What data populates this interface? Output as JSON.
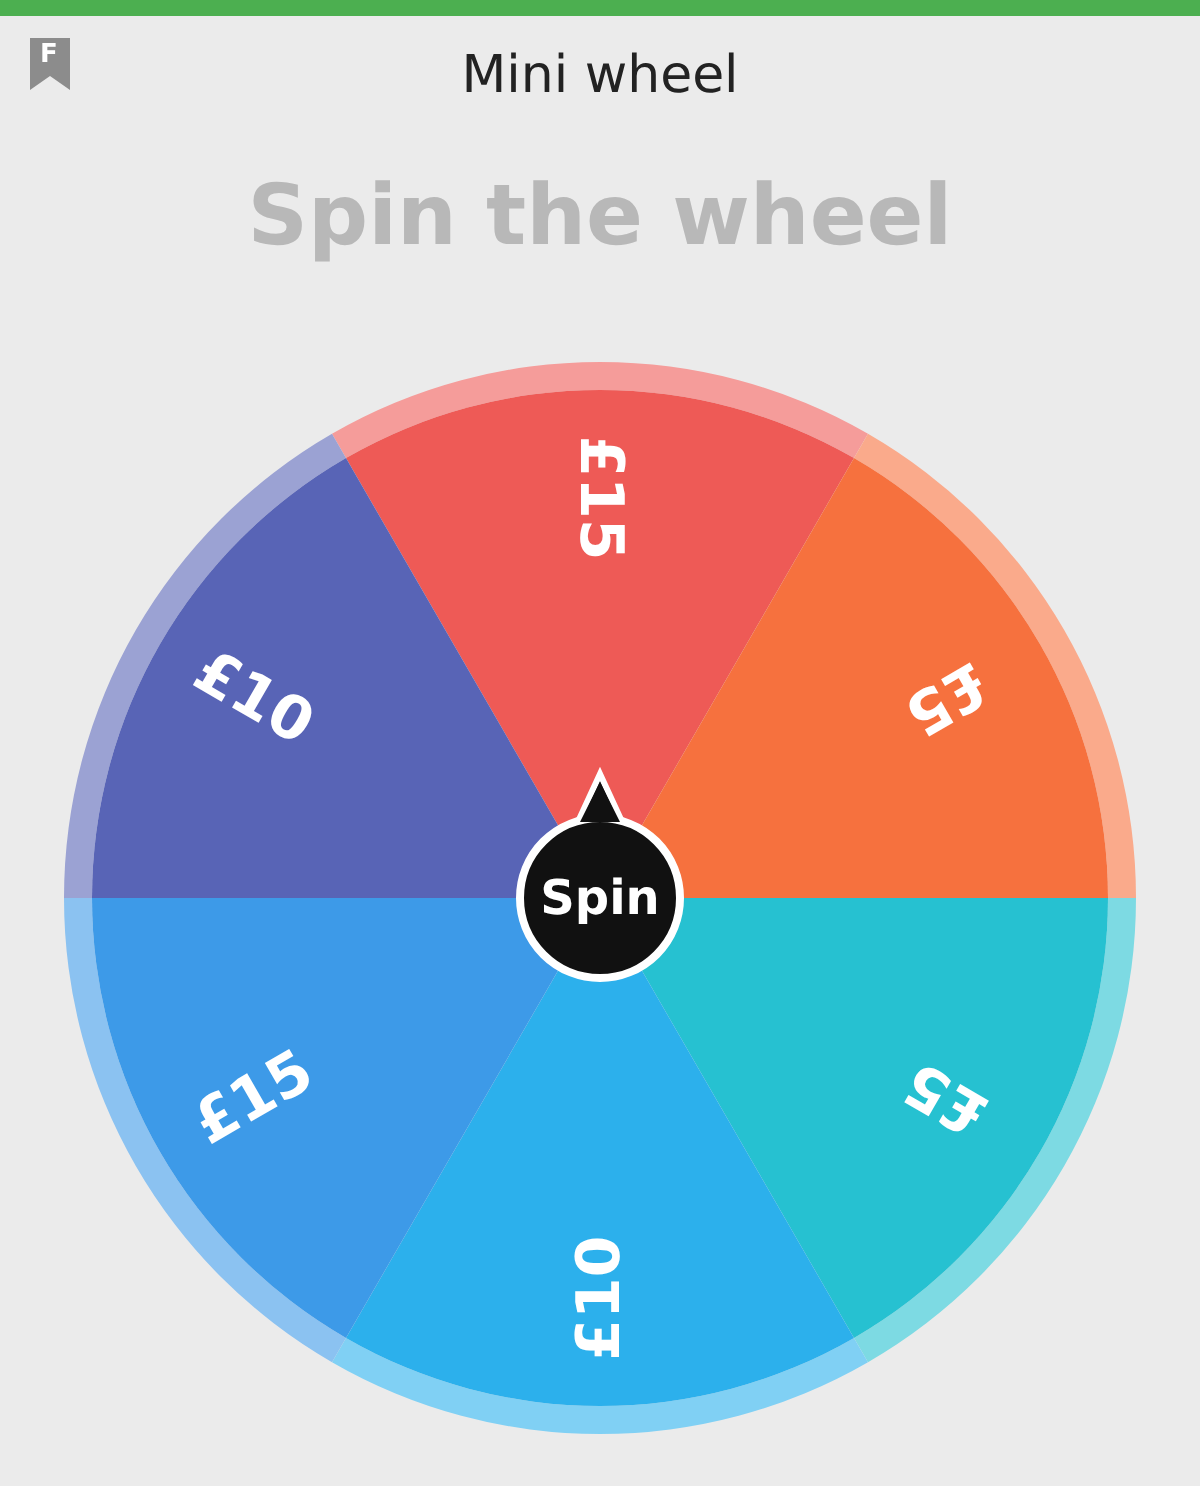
{
  "header": {
    "bookmark_letter": "F",
    "title": "Mini wheel"
  },
  "heading": "Spin the wheel",
  "wheel": {
    "segments": [
      {
        "label": "£15",
        "color": "#ee5a56"
      },
      {
        "label": "£5",
        "color": "#f6713e"
      },
      {
        "label": "£5",
        "color": "#26c1d1"
      },
      {
        "label": "£10",
        "color": "#2cb0ec"
      },
      {
        "label": "£15",
        "color": "#3d9ae8"
      },
      {
        "label": "£10",
        "color": "#5864b6"
      }
    ],
    "spin_label": "Spin"
  }
}
